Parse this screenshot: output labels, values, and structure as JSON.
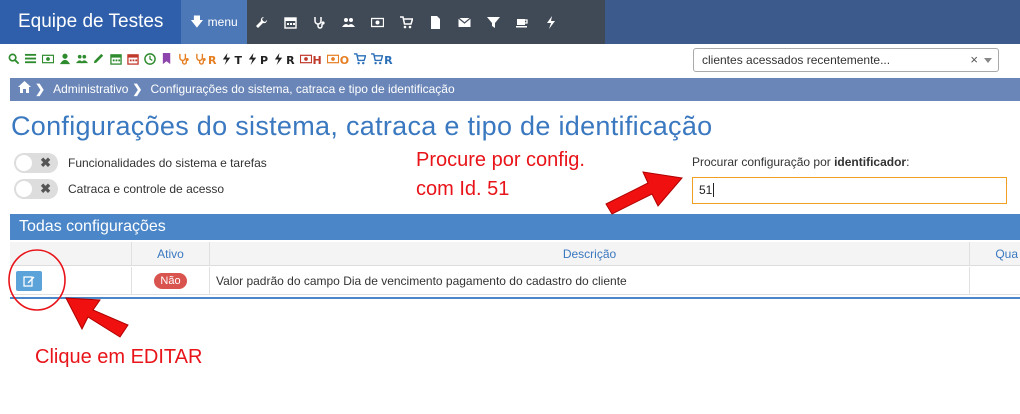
{
  "app": {
    "title": "Equipe de Testes",
    "menu_label": "menu"
  },
  "top_icons": [
    "wrench-icon",
    "calendar-icon",
    "stethoscope-icon",
    "users-icon",
    "money-icon",
    "cart-icon",
    "file-icon",
    "envelope-icon",
    "filter-icon",
    "coffee-icon",
    "bolt-icon"
  ],
  "toolbar": {
    "items": [
      {
        "icon": "search-icon",
        "text": "",
        "color": "#2e8b2e"
      },
      {
        "icon": "list-icon",
        "text": "",
        "color": "#2e8b2e"
      },
      {
        "icon": "money-icon",
        "text": "",
        "color": "#2e8b2e"
      },
      {
        "icon": "user-icon",
        "text": "",
        "color": "#2e8b2e"
      },
      {
        "icon": "users-icon",
        "text": "",
        "color": "#2e8b2e"
      },
      {
        "icon": "pencil-icon",
        "text": "",
        "color": "#2e8b2e"
      },
      {
        "icon": "calendar-icon",
        "text": "",
        "color": "#2e8b2e"
      },
      {
        "icon": "calendar-icon",
        "text": "",
        "color": "#c0392b"
      },
      {
        "icon": "clock-icon",
        "text": "",
        "color": "#2e8b2e"
      },
      {
        "icon": "bookmark-icon",
        "text": "",
        "color": "#8e44ad"
      },
      {
        "icon": "stethoscope-icon",
        "text": "",
        "color": "#e67e22"
      },
      {
        "icon": "stethoscope-icon",
        "text": "R",
        "color": "#e67e22"
      },
      {
        "icon": "bolt-icon",
        "text": "T",
        "color": "#222222"
      },
      {
        "icon": "bolt-icon",
        "text": "P",
        "color": "#222222"
      },
      {
        "icon": "bolt-icon",
        "text": "R",
        "color": "#222222"
      },
      {
        "icon": "money-icon",
        "text": "H",
        "color": "#c0392b"
      },
      {
        "icon": "money-icon",
        "text": "O",
        "color": "#e67e22"
      },
      {
        "icon": "cart-icon",
        "text": "",
        "color": "#2a6fb8"
      },
      {
        "icon": "cart-icon",
        "text": "R",
        "color": "#2a6fb8"
      }
    ]
  },
  "recent_select": {
    "value": "clientes acessados recentemente...",
    "clear": "×"
  },
  "breadcrumb": {
    "items": [
      "Administrativo",
      "Configurações do sistema, catraca e tipo de identificação"
    ]
  },
  "page_title": "Configurações do sistema, catraca e tipo de identificação",
  "toggles": [
    {
      "label": "Funcionalidades do sistema e tarefas",
      "on": false
    },
    {
      "label": "Catraca e controle de acesso",
      "on": false
    }
  ],
  "annotations": {
    "search_hint_line1": "Procure por config.",
    "search_hint_line2": "com Id. 51",
    "edit_hint": "Clique em EDITAR",
    "color": "#e8141a"
  },
  "search": {
    "label_prefix": "Procurar configuração por ",
    "label_bold": "identificador",
    "label_suffix": ":",
    "value": "51"
  },
  "panel": {
    "title": "Todas configurações",
    "columns": [
      "",
      "Ativo",
      "Descrição",
      "Qua"
    ],
    "rows": [
      {
        "ativo": "Não",
        "descricao": "Valor padrão do campo Dia de vencimento pagamento do cadastro do cliente"
      }
    ]
  }
}
